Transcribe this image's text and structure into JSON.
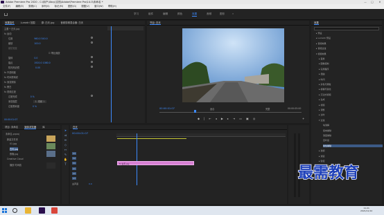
{
  "window": {
    "title": "Adobe Premiere Pro 2020 - C:\\用户\\Xbsy\\文档\\Adobe\\Premiere Pro\\14.0\\未命名 *",
    "min": "—",
    "max": "□",
    "close": "✕"
  },
  "menu": [
    "文件(F)",
    "编辑(E)",
    "剪辑(C)",
    "序列(S)",
    "标记(M)",
    "图形(G)",
    "视图(V)",
    "窗口(W)",
    "帮助(H)"
  ],
  "workspaces": [
    {
      "label": "学习",
      "active": false
    },
    {
      "label": "组件",
      "active": false
    },
    {
      "label": "编辑",
      "active": false
    },
    {
      "label": "颜色",
      "active": false
    },
    {
      "label": "效果",
      "active": true
    },
    {
      "label": "音频",
      "active": false
    },
    {
      "label": "图形",
      "active": false
    }
  ],
  "effect_controls": {
    "tabs": [
      "效果控件",
      "Lumetri 范围",
      "源: 白天.jpg",
      "音频剪辑混合器: 白天"
    ],
    "rows": [
      {
        "label": "主要 * 白天.jpg",
        "value": ""
      },
      {
        "label": "fx 运动",
        "value": ""
      },
      {
        "label": "位置",
        "value": "960.0   540.0"
      },
      {
        "label": "缩放",
        "value": "100.0"
      },
      {
        "label": "缩放宽度",
        "value": ""
      },
      {
        "label": "",
        "value": "☑ 等比缩放"
      },
      {
        "label": "旋转",
        "value": "0.0"
      },
      {
        "label": "锚点",
        "value": "1920.0   1080.0"
      },
      {
        "label": "防闪烁滤镜",
        "value": "0.00"
      },
      {
        "label": "fx 不透明度",
        "value": ""
      },
      {
        "label": "fx 时间重映射",
        "value": ""
      },
      {
        "label": "fx 渐变擦除",
        "value": ""
      },
      {
        "label": "fx 黑白",
        "value": ""
      },
      {
        "label": "fx 视频过渡",
        "value": ""
      },
      {
        "label": "过渡完成",
        "value": "0 %"
      },
      {
        "label": "渐变图层",
        "value": "1. 视频 1"
      },
      {
        "label": "过渡柔和度",
        "value": "0 %"
      }
    ],
    "timecode": "00:00:01:07"
  },
  "program": {
    "title": "节目: 白天",
    "timecode": "00:00:01:07",
    "fit": "适合",
    "quality": "完整",
    "duration": "00:00:05:00"
  },
  "effects_panel": {
    "title": "效果",
    "items": [
      {
        "label": "▸ 预设",
        "sel": false
      },
      {
        "label": "▸ Lumetri 预设",
        "sel": false
      },
      {
        "label": "▸ 音频效果",
        "sel": false
      },
      {
        "label": "▸ 音频过渡",
        "sel": false
      },
      {
        "label": "▾ 视频效果",
        "sel": false
      },
      {
        "label": "▸ 变换",
        "sel": false
      },
      {
        "label": "▸ 图像控制",
        "sel": false
      },
      {
        "label": "▸ 实用程序",
        "sel": false
      },
      {
        "label": "▸ 扭曲",
        "sel": false
      },
      {
        "label": "▸ 时间",
        "sel": false
      },
      {
        "label": "▸ 杂色与颗粒",
        "sel": false
      },
      {
        "label": "▸ 模糊与锐化",
        "sel": false
      },
      {
        "label": "▸ 沉浸式视频",
        "sel": false
      },
      {
        "label": "▸ 生成",
        "sel": false
      },
      {
        "label": "▸ 视频",
        "sel": false
      },
      {
        "label": "▸ 调整",
        "sel": false
      },
      {
        "label": "▸ 过时",
        "sel": false
      },
      {
        "label": "▾ 过渡",
        "sel": false
      },
      {
        "label": "块溶解",
        "sel": false
      },
      {
        "label": "径向擦除",
        "sel": false
      },
      {
        "label": "渐变擦除",
        "sel": false
      },
      {
        "label": "百叶窗",
        "sel": false
      },
      {
        "label": "线性擦除",
        "sel": true
      },
      {
        "label": "▸ 透视",
        "sel": false
      },
      {
        "label": "▸ 通道",
        "sel": false
      },
      {
        "label": "▸ 键控",
        "sel": false
      },
      {
        "label": "▸ 颜色校正",
        "sel": false
      },
      {
        "label": "▸ 风格化",
        "sel": false
      },
      {
        "label": "▸ 视频过渡",
        "sel": false
      }
    ]
  },
  "project": {
    "tabs": [
      "项目: 未命名",
      "媒体浏览器",
      "库"
    ],
    "name": "未命名.prproj",
    "items": [
      "新建文件夹",
      "01.jpg",
      "白天.jpg",
      "夜晚.jpg",
      "Creative Cloud",
      "播放 时间线"
    ]
  },
  "timeline": {
    "title": "白天",
    "timecode": "00:00:01:07",
    "tracks": [
      "V3",
      "V2",
      "V1",
      "A1",
      "A2",
      "A3",
      "主声道"
    ],
    "clip_label": "fx 白天.jpg",
    "master_value": "0.0"
  },
  "watermark": "最需教育",
  "taskbar": {
    "time": "11:21",
    "date": "2021/11/12"
  }
}
